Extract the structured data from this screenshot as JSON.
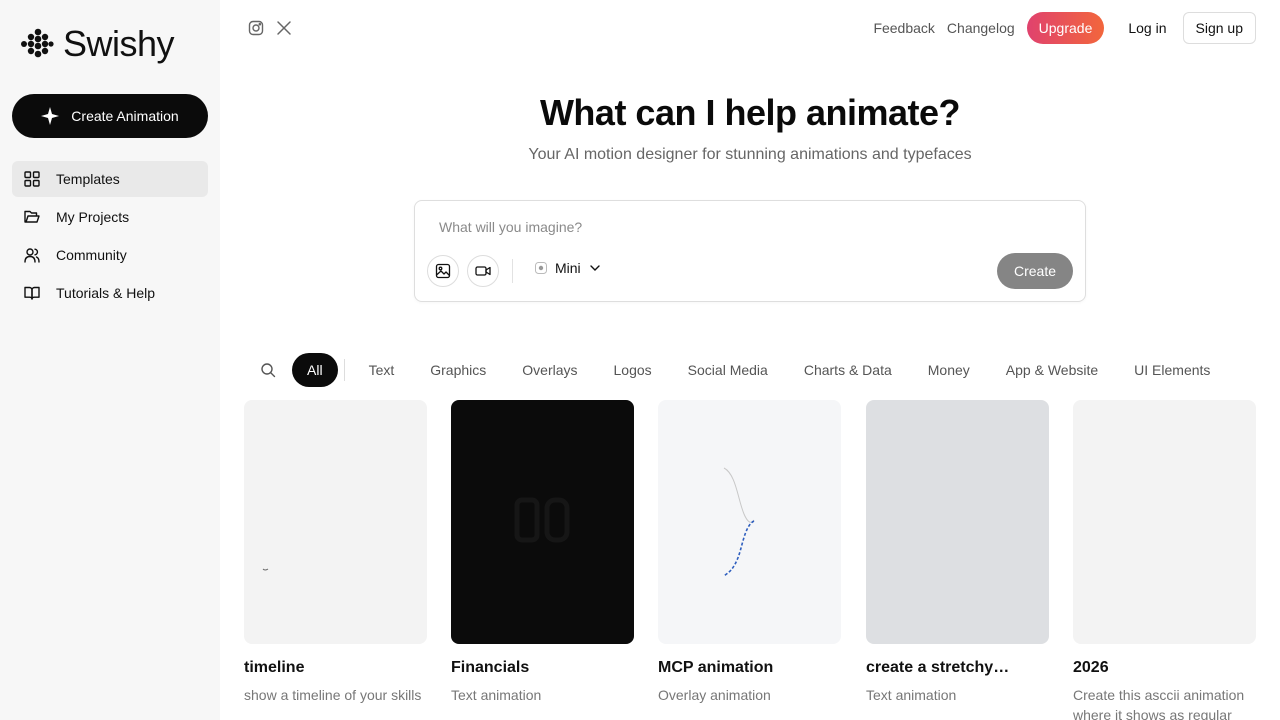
{
  "brand": {
    "name": "Swishy"
  },
  "sidebar": {
    "create_label": "Create Animation",
    "items": [
      {
        "label": "Templates",
        "icon": "grid-icon",
        "active": true
      },
      {
        "label": "My Projects",
        "icon": "folder-icon",
        "active": false
      },
      {
        "label": "Community",
        "icon": "users-icon",
        "active": false
      },
      {
        "label": "Tutorials & Help",
        "icon": "book-icon",
        "active": false
      }
    ]
  },
  "header": {
    "social": [
      "instagram-icon",
      "x-icon"
    ],
    "feedback": "Feedback",
    "changelog": "Changelog",
    "upgrade": "Upgrade",
    "login": "Log in",
    "signup": "Sign up"
  },
  "hero": {
    "title": "What can I help animate?",
    "subtitle": "Your AI motion designer for stunning animations and typefaces"
  },
  "prompt": {
    "placeholder": "What will you imagine?",
    "model": "Mini",
    "submit": "Create"
  },
  "filters": {
    "active": "All",
    "items": [
      "Text",
      "Graphics",
      "Overlays",
      "Logos",
      "Social Media",
      "Charts & Data",
      "Money",
      "App & Website",
      "UI Elements"
    ]
  },
  "cards": [
    {
      "title": "timeline",
      "subtitle": "show a timeline of your skills",
      "bg": "#f3f3f3"
    },
    {
      "title": "Financials",
      "subtitle": "Text animation",
      "bg": "#0b0b0b"
    },
    {
      "title": "MCP animation",
      "subtitle": "Overlay animation",
      "bg": "#f5f6f8"
    },
    {
      "title": "create a stretchy…",
      "subtitle": "Text animation",
      "bg": "#dddfe2"
    },
    {
      "title": "2026",
      "subtitle": "Create this asccii animation where it shows as regular",
      "bg": "#f3f3f3"
    }
  ],
  "colors": {
    "accent_gradient_start": "#e0426e",
    "accent_gradient_end": "#f2663c",
    "primary_dark": "#0b0b0b"
  }
}
